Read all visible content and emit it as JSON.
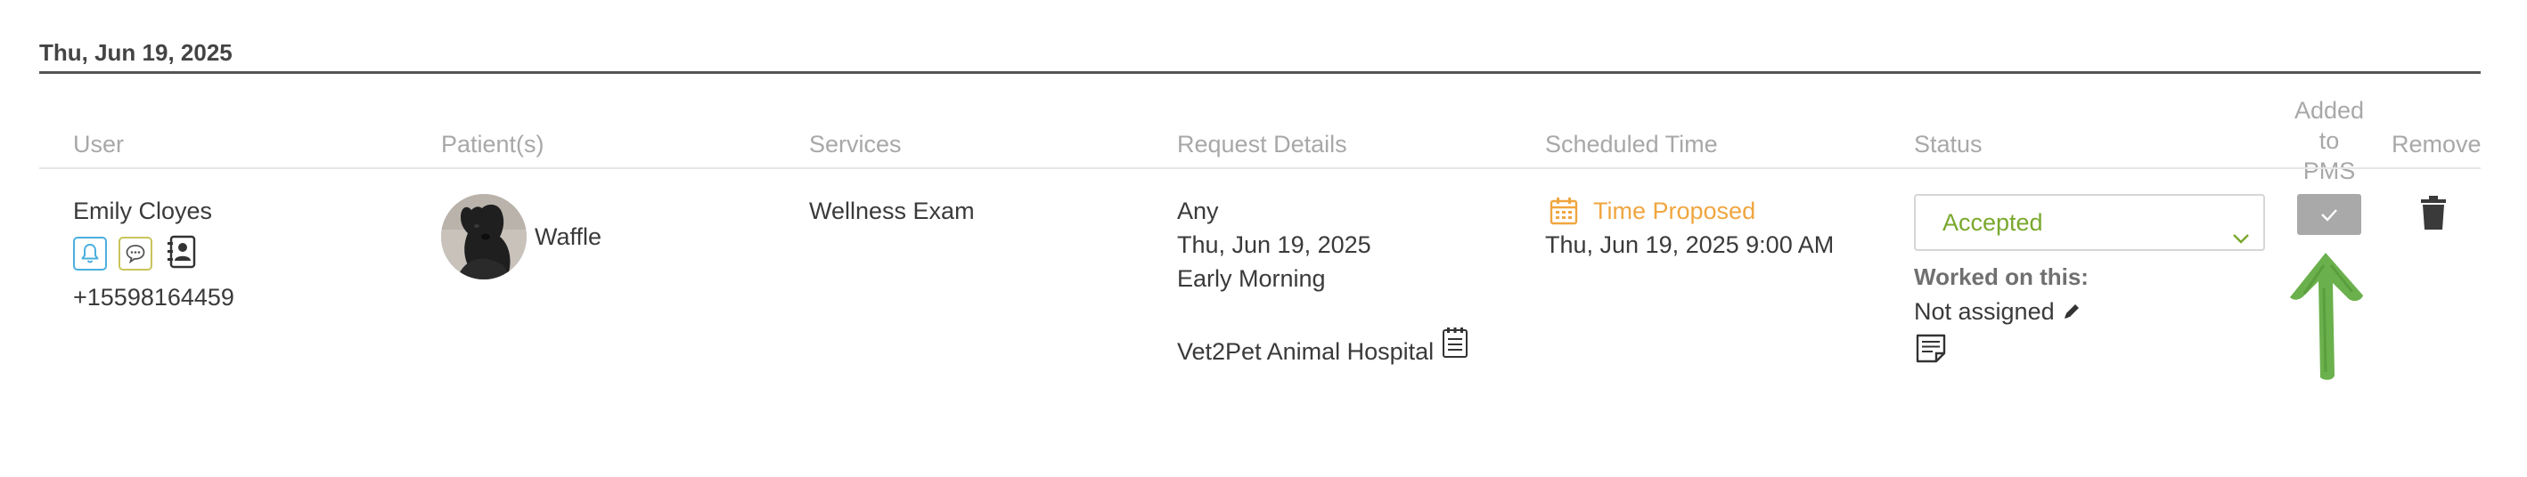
{
  "date_header": "Thu, Jun 19, 2025",
  "columns": {
    "user": "User",
    "patients": "Patient(s)",
    "services": "Services",
    "request_details": "Request Details",
    "scheduled_time": "Scheduled Time",
    "status": "Status",
    "added_to_pms_line1": "Added",
    "added_to_pms_line2": "to PMS",
    "remove": "Remove"
  },
  "row": {
    "user_name": "Emily Cloyes",
    "user_phone": "+15598164459",
    "user_icons": [
      "bell-icon",
      "chat-icon",
      "contact-card-icon"
    ],
    "patient_name": "Waffle",
    "service": "Wellness Exam",
    "request_preference": "Any",
    "request_date": "Thu, Jun 19, 2025",
    "request_time_of_day": "Early Morning",
    "request_hospital": "Vet2Pet Animal Hospital",
    "scheduled_status_label": "Time Proposed",
    "scheduled_datetime": "Thu, Jun 19, 2025 9:00 AM",
    "status_value": "Accepted",
    "worked_on_label": "Worked on this:",
    "worked_on_value": "Not assigned"
  },
  "colors": {
    "accent_orange": "#f0a640",
    "status_green": "#7aa82d",
    "bell_blue": "#4ab0de",
    "chat_yellow": "#c9c45a",
    "arrow_green": "#6ab04c",
    "pms_gray": "#a9a9a9"
  }
}
